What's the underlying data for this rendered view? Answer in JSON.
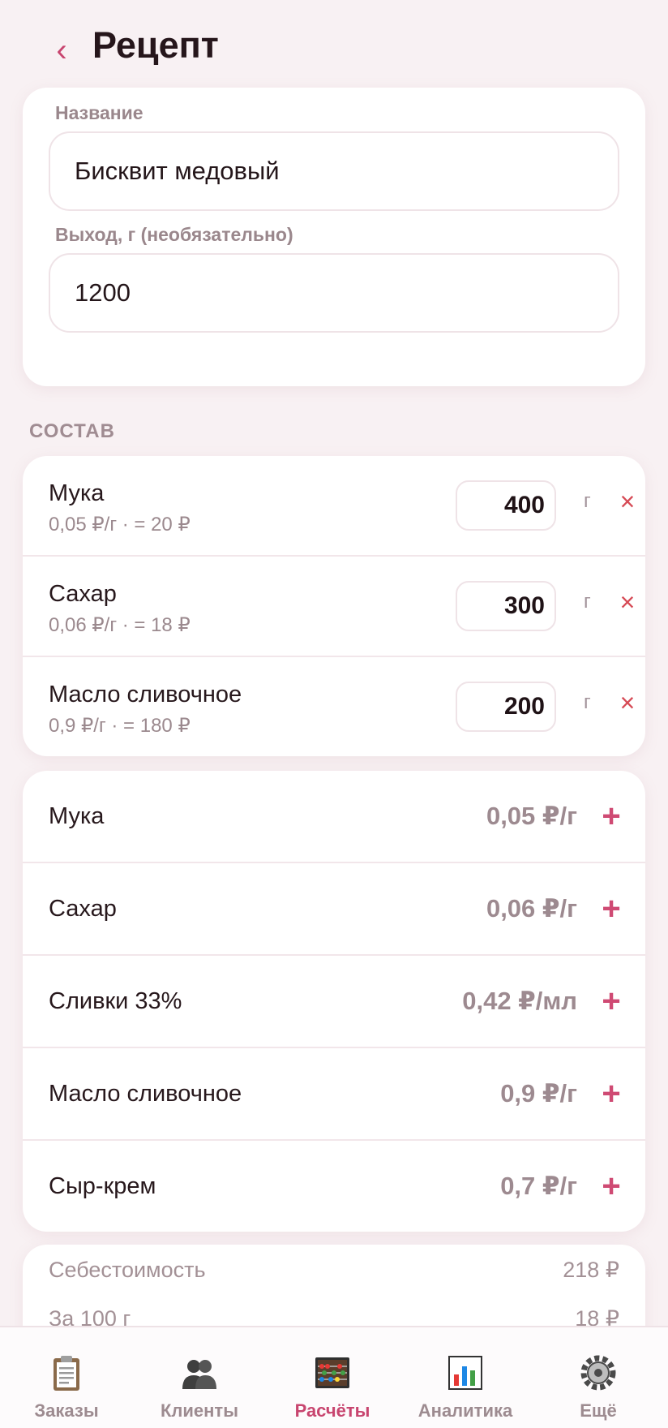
{
  "header": {
    "back_label": "‹",
    "title": "Рецепт"
  },
  "form": {
    "name_label": "Название",
    "name_value": "Бисквит медовый",
    "yield_label": "Выход, г (необязательно)",
    "yield_value": "1200"
  },
  "composition": {
    "section_label": "СОСТАВ",
    "items": [
      {
        "name": "Мука",
        "detail": "0,05 ₽/г · = 20 ₽",
        "qty": "400",
        "unit": "г"
      },
      {
        "name": "Сахар",
        "detail": "0,06 ₽/г · = 18 ₽",
        "qty": "300",
        "unit": "г"
      },
      {
        "name": "Масло сливочное",
        "detail": "0,9 ₽/г · = 180 ₽",
        "qty": "200",
        "unit": "г"
      }
    ],
    "remove_label": "×"
  },
  "catalog": {
    "add_label": "+",
    "items": [
      {
        "name": "Мука",
        "price": "0,05 ₽/г"
      },
      {
        "name": "Сахар",
        "price": "0,06 ₽/г"
      },
      {
        "name": "Сливки 33%",
        "price": "0,42 ₽/мл"
      },
      {
        "name": "Масло сливочное",
        "price": "0,9 ₽/г"
      },
      {
        "name": "Сыр-крем",
        "price": "0,7 ₽/г"
      }
    ]
  },
  "summary": {
    "cost_label": "Себестоимость",
    "cost_value": "218 ₽",
    "per100_label": "За 100 г",
    "per100_value": "18 ₽"
  },
  "nav": {
    "active": "calculations",
    "items": [
      {
        "id": "orders",
        "label": "Заказы",
        "icon": "clipboard-icon"
      },
      {
        "id": "clients",
        "label": "Клиенты",
        "icon": "people-icon"
      },
      {
        "id": "calculations",
        "label": "Расчёты",
        "icon": "abacus-icon"
      },
      {
        "id": "analytics",
        "label": "Аналитика",
        "icon": "bar-chart-icon"
      },
      {
        "id": "more",
        "label": "Ещё",
        "icon": "gear-icon"
      }
    ]
  },
  "colors": {
    "accent": "#c8456f",
    "remove": "#d64a55",
    "background": "#f8f1f3",
    "muted": "#9d8a90"
  }
}
